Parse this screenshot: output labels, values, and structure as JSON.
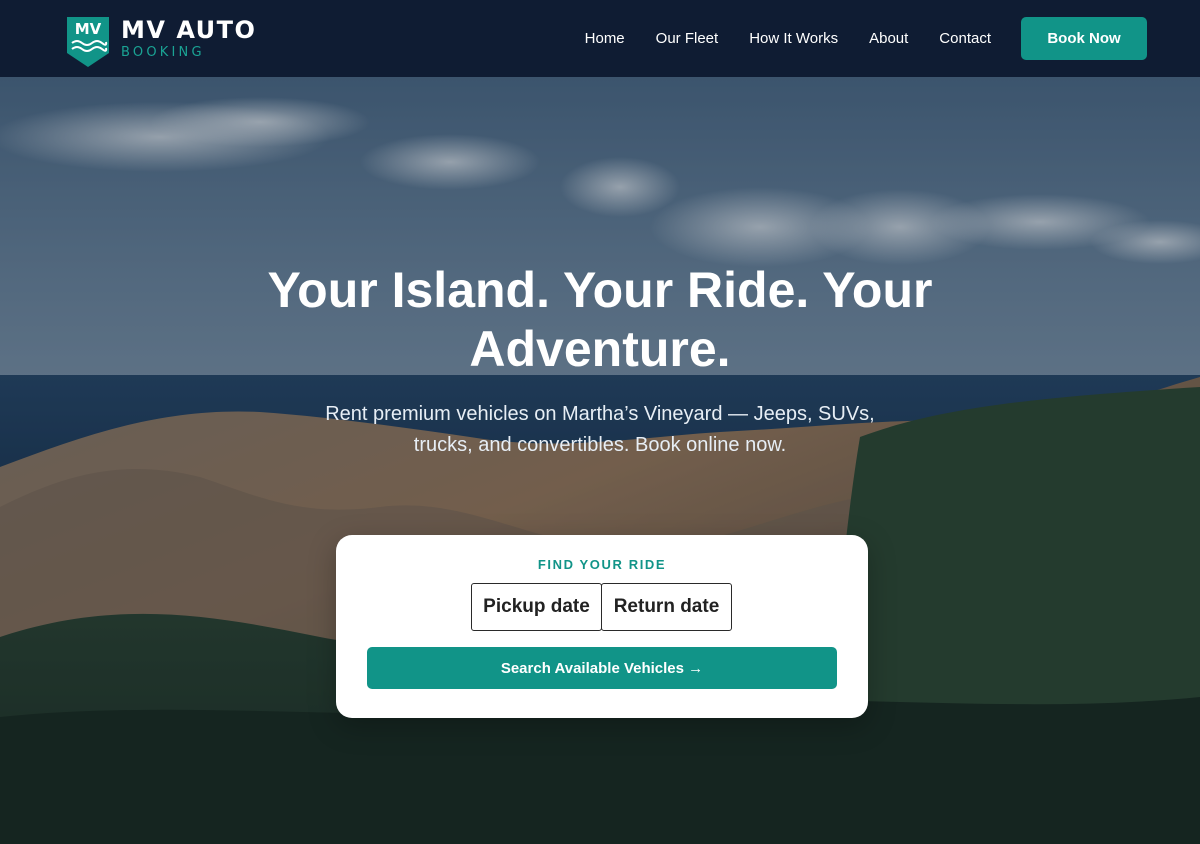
{
  "brand": {
    "badge": "MV",
    "name": "MV AUTO",
    "tagline": "BOOKING",
    "accent_color": "#119488",
    "nav_bg_color": "#0f1c33"
  },
  "nav": {
    "items": [
      {
        "label": "Home"
      },
      {
        "label": "Our Fleet"
      },
      {
        "label": "How It Works"
      },
      {
        "label": "About"
      },
      {
        "label": "Contact"
      }
    ],
    "cta_label": "Book Now"
  },
  "hero": {
    "headline_line1": "Your Island. Your Ride. Your",
    "headline_line2": "Adventure.",
    "sub_line1": "Rent premium vehicles on Martha’s Vineyard — Jeeps, SUVs,",
    "sub_line2": "trucks, and convertibles. Book online now.",
    "background": "coastal-cliffs-photo"
  },
  "search": {
    "title": "FIND YOUR RIDE",
    "pickup_label": "Pickup date",
    "return_label": "Return date",
    "submit_label": "Search Available Vehicles →"
  }
}
